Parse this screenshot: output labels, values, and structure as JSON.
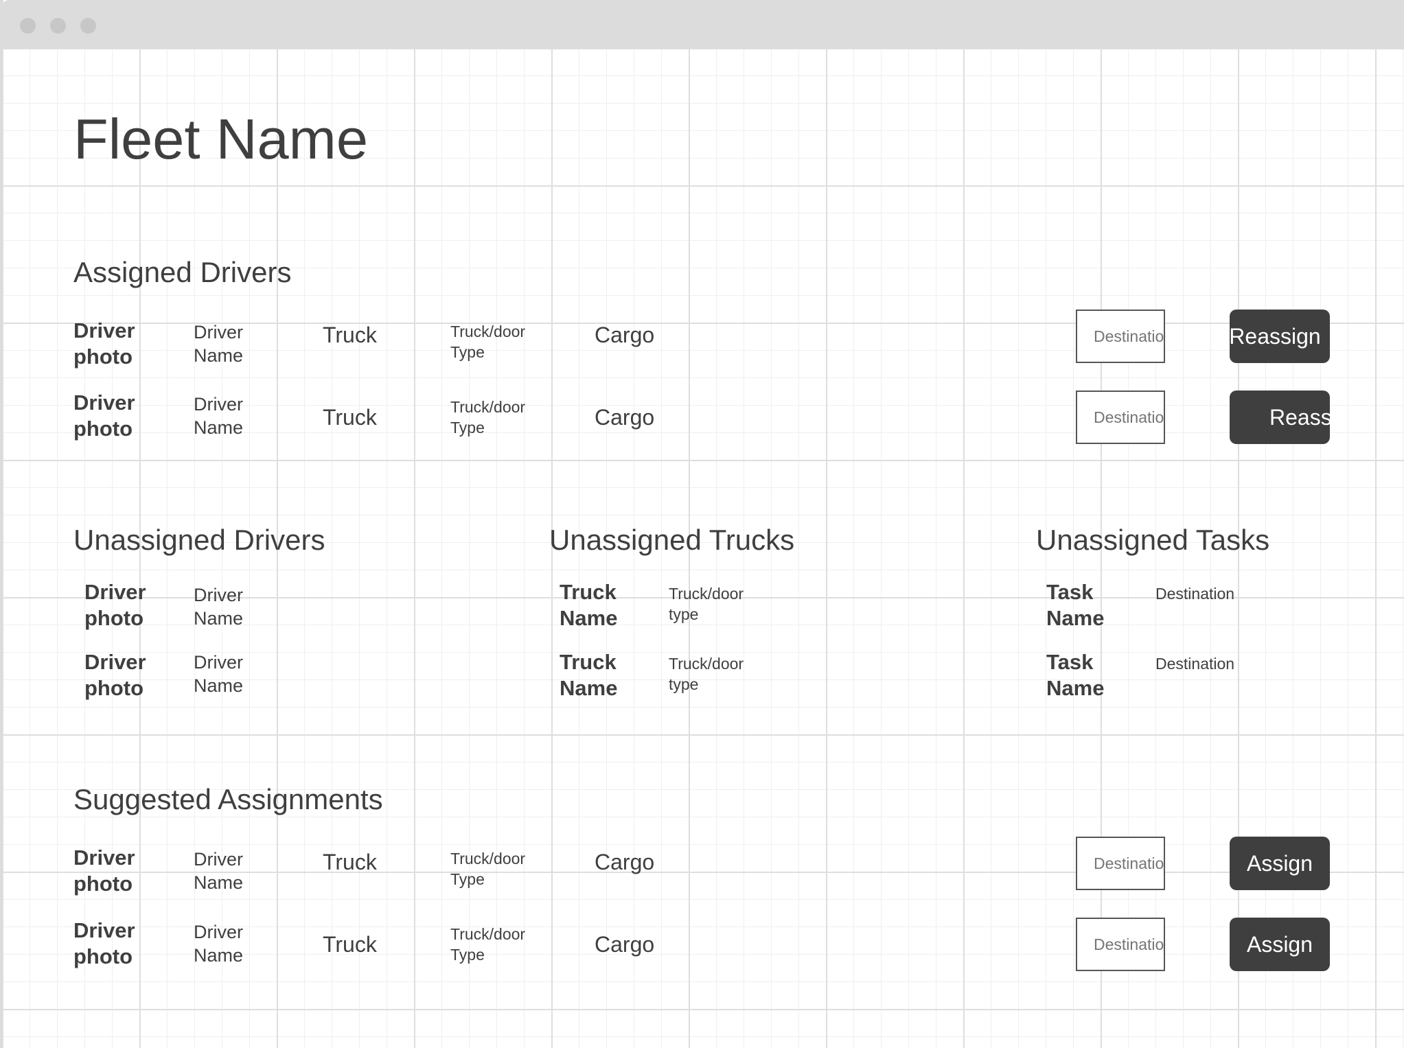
{
  "page_title": "Fleet Name",
  "assigned": {
    "title": "Assigned Drivers",
    "rows": [
      {
        "photo": "Driver photo",
        "name": "Driver Name",
        "truck": "Truck",
        "type": "Truck/door Type",
        "cargo": "Cargo",
        "dest_placeholder": "Destination",
        "button": "Reassign"
      },
      {
        "photo": "Driver photo",
        "name": "Driver Name",
        "truck": "Truck",
        "type": "Truck/door Type",
        "cargo": "Cargo",
        "dest_placeholder": "Destination",
        "button": "Reassign"
      }
    ]
  },
  "unassigned_drivers": {
    "title": "Unassigned Drivers",
    "rows": [
      {
        "photo": "Driver photo",
        "name": "Driver Name"
      },
      {
        "photo": "Driver photo",
        "name": "Driver Name"
      }
    ]
  },
  "unassigned_trucks": {
    "title": "Unassigned Trucks",
    "rows": [
      {
        "name": "Truck Name",
        "type": "Truck/door type"
      },
      {
        "name": "Truck Name",
        "type": "Truck/door type"
      }
    ]
  },
  "unassigned_tasks": {
    "title": "Unassigned Tasks",
    "rows": [
      {
        "name": "Task Name",
        "destination": "Destination"
      },
      {
        "name": "Task Name",
        "destination": "Destination"
      }
    ]
  },
  "suggested": {
    "title": "Suggested Assignments",
    "rows": [
      {
        "photo": "Driver photo",
        "name": "Driver Name",
        "truck": "Truck",
        "type": "Truck/door Type",
        "cargo": "Cargo",
        "dest_placeholder": "Destination",
        "button": "Assign"
      },
      {
        "photo": "Driver photo",
        "name": "Driver Name",
        "truck": "Truck",
        "type": "Truck/door Type",
        "cargo": "Cargo",
        "dest_placeholder": "Destination",
        "button": "Assign"
      }
    ]
  }
}
